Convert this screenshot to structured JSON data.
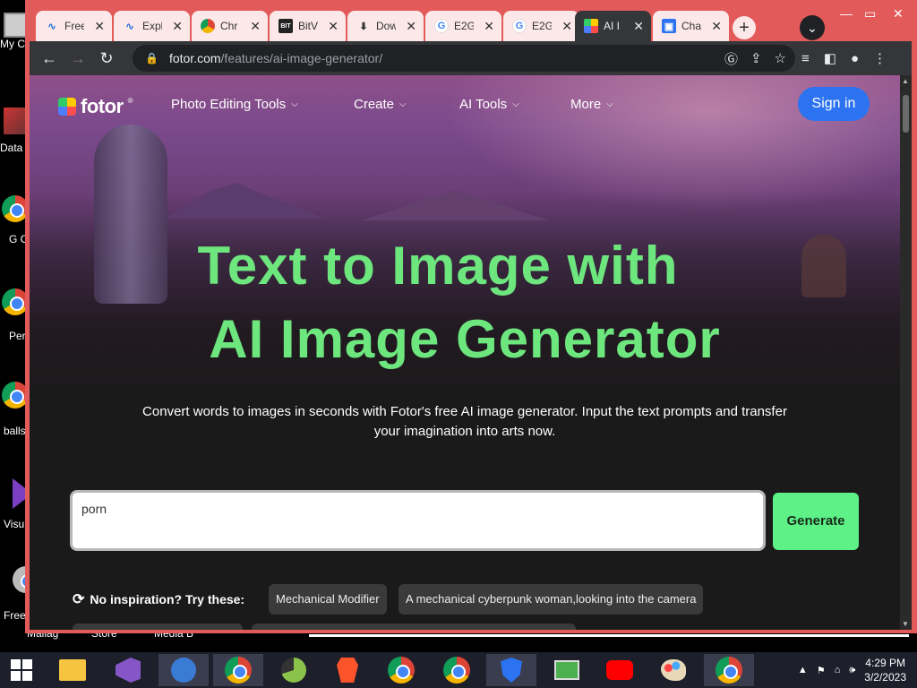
{
  "desktop": {
    "icons": [
      {
        "label": "My C"
      },
      {
        "label": "Data"
      },
      {
        "label": "G Ch"
      },
      {
        "label": "Per Ch"
      },
      {
        "label": "balls Ch"
      },
      {
        "label": "Visu"
      },
      {
        "label": "Free Manag"
      }
    ],
    "partial_labels": [
      "Mallag",
      "Store",
      "Media B"
    ]
  },
  "browser": {
    "tabs": [
      {
        "title": "Free",
        "icon": "wave-icon"
      },
      {
        "title": "Expl",
        "icon": "wave-icon"
      },
      {
        "title": "Chr",
        "icon": "chrome-icon"
      },
      {
        "title": "BitV",
        "icon": "bitview-icon"
      },
      {
        "title": "Dow",
        "icon": "download-icon"
      },
      {
        "title": "E2G",
        "icon": "google-icon"
      },
      {
        "title": "E2G",
        "icon": "google-icon"
      },
      {
        "title": "AI I",
        "icon": "fotor-icon"
      },
      {
        "title": "Cha",
        "icon": "chat-icon"
      }
    ],
    "active_tab_index": 7,
    "url_domain": "fotor.com",
    "url_path": "/features/ai-image-generator/"
  },
  "page": {
    "logo_text": "fotor",
    "logo_reg": "®",
    "nav": [
      {
        "label": "Photo Editing Tools"
      },
      {
        "label": "Create"
      },
      {
        "label": "AI Tools"
      },
      {
        "label": "More"
      }
    ],
    "signin_label": "Sign in",
    "hero_line1": "Text to Image with",
    "hero_line2": "AI Image Generator",
    "hero_sub": "Convert words to images in seconds with Fotor's free AI image generator. Input the text prompts and transfer your imagination into arts now.",
    "prompt_value": "porn",
    "generate_label": "Generate",
    "inspiration_label": "No inspiration? Try these:",
    "suggestions": [
      "Mechanical Modifier",
      "A mechanical cyberpunk woman,looking into the camera"
    ],
    "colors": {
      "hero_green": "#6de67e",
      "generate_green": "#5df188",
      "signin_blue": "#2b73f0",
      "window_border": "#e35a5a"
    }
  },
  "taskbar": {
    "time": "4:29 PM",
    "date": "3/2/2023",
    "items": [
      "start-icon",
      "file-explorer-icon",
      "visual-studio-icon",
      "tools-icon",
      "chrome-user-icon",
      "cleaner-icon",
      "brave-icon",
      "chrome-profile-icon",
      "chrome-profile2-icon",
      "defender-icon",
      "terminal-icon",
      "youtube-icon",
      "paint-icon",
      "chrome-icon"
    ]
  }
}
